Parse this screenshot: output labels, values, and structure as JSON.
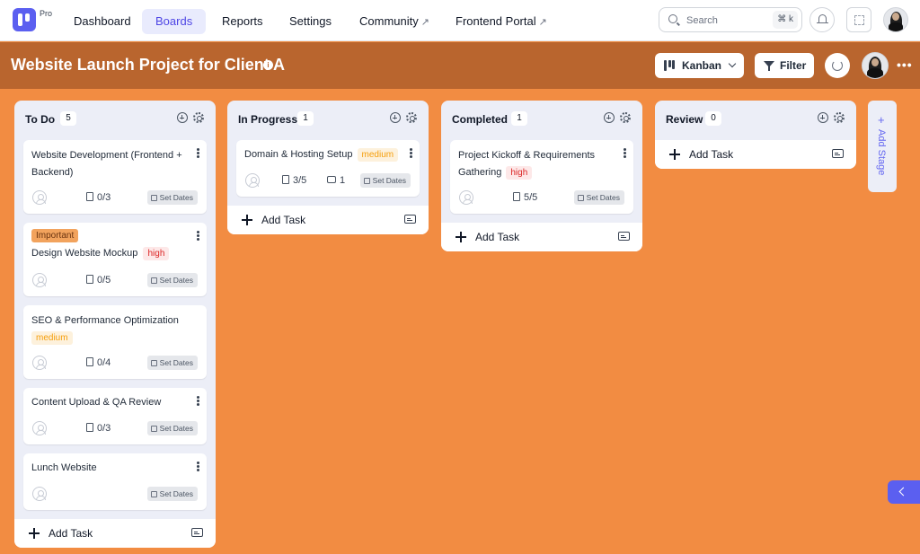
{
  "app": {
    "badge": "Pro"
  },
  "nav": {
    "items": [
      "Dashboard",
      "Boards",
      "Reports",
      "Settings",
      "Community",
      "Frontend Portal"
    ],
    "active": "Boards"
  },
  "search": {
    "placeholder": "Search",
    "shortcut": "⌘ k"
  },
  "project": {
    "title": "Website Launch Project for Client A",
    "view_label": "Kanban",
    "filter_label": "Filter"
  },
  "colors": {
    "board_bg": "#f28c42",
    "header_bg": "#b9652e",
    "accent": "#5b5ff0"
  },
  "columns": [
    {
      "title": "To Do",
      "count": "5",
      "add_label": "Add Task",
      "cards": [
        {
          "title": "Website Development (Frontend + Backend)",
          "subtasks": "0/3",
          "dates": "Set Dates"
        },
        {
          "label": "Important",
          "title": "Design Website Mockup",
          "priority": "high",
          "subtasks": "0/5",
          "dates": "Set Dates"
        },
        {
          "title": "SEO & Performance Optimization",
          "priority": "medium",
          "subtasks": "0/4",
          "dates": "Set Dates"
        },
        {
          "title": "Content Upload & QA Review",
          "subtasks": "0/3",
          "dates": "Set Dates"
        },
        {
          "title": "Lunch Website",
          "dates": "Set Dates"
        }
      ]
    },
    {
      "title": "In Progress",
      "count": "1",
      "add_label": "Add Task",
      "cards": [
        {
          "title": "Domain & Hosting Setup",
          "priority": "medium",
          "subtasks": "3/5",
          "comments": "1",
          "dates": "Set Dates"
        }
      ]
    },
    {
      "title": "Completed",
      "count": "1",
      "add_label": "Add Task",
      "cards": [
        {
          "title": "Project Kickoff & Requirements Gathering",
          "priority": "high",
          "subtasks": "5/5",
          "dates": "Set Dates"
        }
      ]
    },
    {
      "title": "Review",
      "count": "0",
      "add_label": "Add Task",
      "cards": []
    }
  ],
  "add_stage": {
    "label": "Add Stage",
    "icon": "+"
  }
}
